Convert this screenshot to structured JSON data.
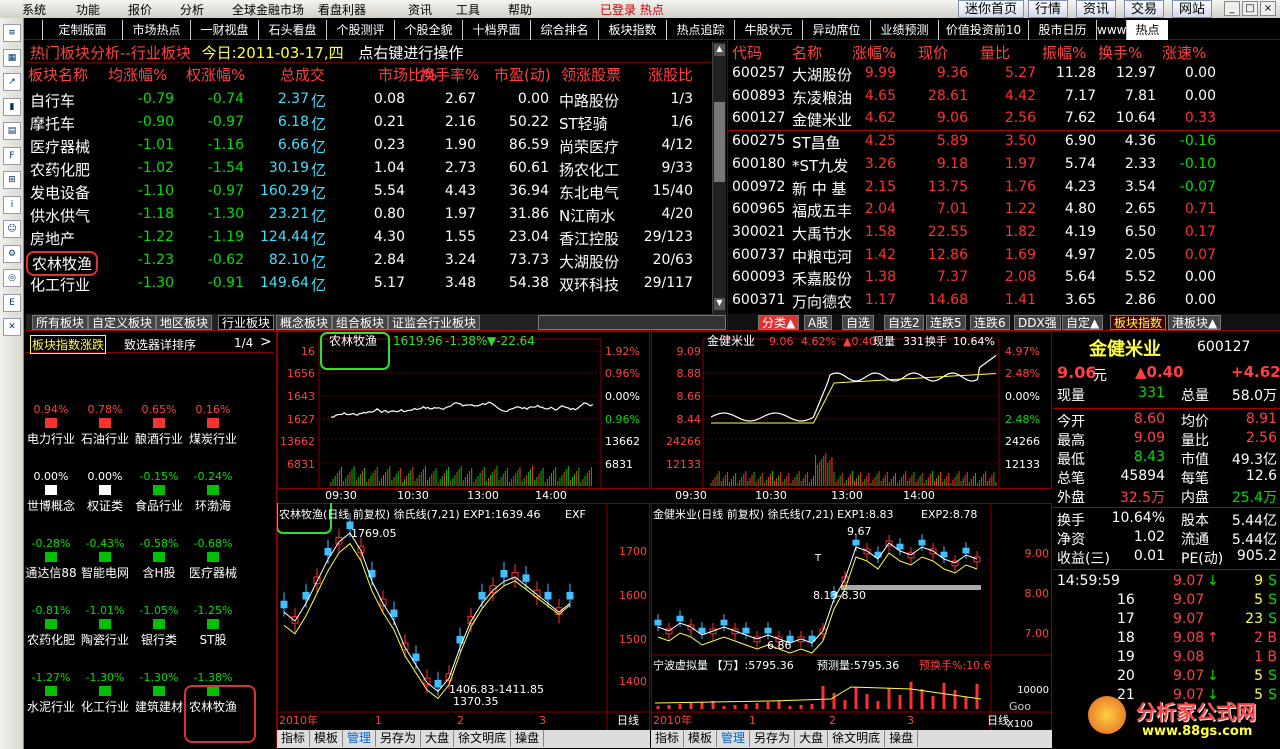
{
  "menu": [
    "系统",
    "功能",
    "报价",
    "分析",
    "全球金融市场",
    "看盘利器",
    "资讯",
    "工具",
    "帮助"
  ],
  "window_title": "已登录 热点",
  "top_buttons": [
    "迷你首页",
    "行情",
    "资讯",
    "交易",
    "网站"
  ],
  "window_controls": [
    "_",
    "□",
    "×"
  ],
  "tabs": [
    "定制版面",
    "市场热点",
    "一财视盘",
    "石头看盘",
    "个股测评",
    "个股全貌",
    "十档界面",
    "综合排名",
    "板块指数",
    "热点追踪",
    "牛股状元",
    "异动席位",
    "业绩预测",
    "价值投资前10",
    "股市日历",
    "www",
    "热点"
  ],
  "section_title": "热门板块分析--行业板块",
  "section_date": "今日:2011-03-17,四",
  "section_hint": "点右键进行操作",
  "left_headers": [
    "板块名称",
    "均涨幅%",
    "权涨幅%",
    "总成交",
    "市场比%",
    "换手率%",
    "市盈(动)",
    "领涨股票",
    "涨股比"
  ],
  "sectors": [
    {
      "name": "自行车",
      "avg": "-0.79",
      "wt": "-0.74",
      "vol": "2.37",
      "unit": "亿",
      "mkt": "0.08",
      "turn": "2.67",
      "pe": "0.00",
      "lead": "中路股份",
      "ratio": "1/3"
    },
    {
      "name": "摩托车",
      "avg": "-0.90",
      "wt": "-0.97",
      "vol": "6.18",
      "unit": "亿",
      "mkt": "0.21",
      "turn": "2.16",
      "pe": "50.22",
      "lead": "ST轻骑",
      "ratio": "1/6"
    },
    {
      "name": "医疗器械",
      "avg": "-1.01",
      "wt": "-1.16",
      "vol": "6.66",
      "unit": "亿",
      "mkt": "0.23",
      "turn": "1.90",
      "pe": "86.59",
      "lead": "尚荣医疗",
      "ratio": "4/12"
    },
    {
      "name": "农药化肥",
      "avg": "-1.02",
      "wt": "-1.54",
      "vol": "30.19",
      "unit": "亿",
      "mkt": "1.04",
      "turn": "2.73",
      "pe": "60.61",
      "lead": "扬农化工",
      "ratio": "9/33"
    },
    {
      "name": "发电设备",
      "avg": "-1.10",
      "wt": "-0.97",
      "vol": "160.29",
      "unit": "亿",
      "mkt": "5.54",
      "turn": "4.43",
      "pe": "36.94",
      "lead": "东北电气",
      "ratio": "15/40"
    },
    {
      "name": "供水供气",
      "avg": "-1.18",
      "wt": "-1.30",
      "vol": "23.21",
      "unit": "亿",
      "mkt": "0.80",
      "turn": "1.97",
      "pe": "31.86",
      "lead": "N江南水",
      "ratio": "4/20"
    },
    {
      "name": "房地产",
      "avg": "-1.22",
      "wt": "-1.19",
      "vol": "124.44",
      "unit": "亿",
      "mkt": "4.30",
      "turn": "1.55",
      "pe": "23.04",
      "lead": "香江控股",
      "ratio": "29/123"
    },
    {
      "name": "农林牧渔",
      "avg": "-1.23",
      "wt": "-0.62",
      "vol": "82.10",
      "unit": "亿",
      "mkt": "2.84",
      "turn": "3.24",
      "pe": "73.73",
      "lead": "大湖股份",
      "ratio": "20/63"
    },
    {
      "name": "化工行业",
      "avg": "-1.30",
      "wt": "-0.91",
      "vol": "149.64",
      "unit": "亿",
      "mkt": "5.17",
      "turn": "3.48",
      "pe": "54.38",
      "lead": "双环科技",
      "ratio": "29/117"
    }
  ],
  "right_headers": [
    "代码",
    "名称",
    "涨幅%",
    "现价",
    "量比",
    "振幅%",
    "换手%",
    "涨速%"
  ],
  "stocks": [
    {
      "code": "600257",
      "name": "大湖股份",
      "chg": "9.99",
      "price": "9.36",
      "vr": "5.27",
      "amp": "11.28",
      "turn": "12.97",
      "speed": "0.00",
      "sc": "w"
    },
    {
      "code": "600893",
      "name": "东凌粮油",
      "chg": "4.65",
      "price": "28.61",
      "vr": "4.42",
      "amp": "7.17",
      "turn": "7.81",
      "speed": "0.00",
      "sc": "w"
    },
    {
      "code": "600127",
      "name": "金健米业",
      "chg": "4.62",
      "price": "9.06",
      "vr": "2.56",
      "amp": "7.62",
      "turn": "10.64",
      "speed": "0.33",
      "sc": "r"
    },
    {
      "code": "600275",
      "name": "ST昌鱼",
      "chg": "4.25",
      "price": "5.89",
      "vr": "3.50",
      "amp": "6.90",
      "turn": "4.36",
      "speed": "-0.16",
      "sc": "g"
    },
    {
      "code": "600180",
      "name": "*ST九发",
      "chg": "3.26",
      "price": "9.18",
      "vr": "1.97",
      "amp": "5.74",
      "turn": "2.33",
      "speed": "-0.10",
      "sc": "g"
    },
    {
      "code": "000972",
      "name": "新 中 基",
      "chg": "2.15",
      "price": "13.75",
      "vr": "1.76",
      "amp": "4.23",
      "turn": "3.54",
      "speed": "-0.07",
      "sc": "g"
    },
    {
      "code": "600965",
      "name": "福成五丰",
      "chg": "2.04",
      "price": "7.01",
      "vr": "1.22",
      "amp": "4.80",
      "turn": "2.65",
      "speed": "0.71",
      "sc": "r"
    },
    {
      "code": "300021",
      "name": "大禹节水",
      "chg": "1.58",
      "price": "22.55",
      "vr": "1.82",
      "amp": "4.19",
      "turn": "6.50",
      "speed": "0.17",
      "sc": "r"
    },
    {
      "code": "600737",
      "name": "中粮屯河",
      "chg": "1.42",
      "price": "12.86",
      "vr": "1.69",
      "amp": "4.97",
      "turn": "2.05",
      "speed": "0.07",
      "sc": "r"
    },
    {
      "code": "600093",
      "name": "禾嘉股份",
      "chg": "1.38",
      "price": "7.37",
      "vr": "2.08",
      "amp": "5.64",
      "turn": "5.52",
      "speed": "0.00",
      "sc": "w"
    },
    {
      "code": "600371",
      "name": "万向德农",
      "chg": "1.17",
      "price": "14.68",
      "vr": "1.41",
      "amp": "3.65",
      "turn": "2.86",
      "speed": "0.00",
      "sc": "w"
    }
  ],
  "left_bottom_tabs": [
    "所有板块",
    "自定义板块",
    "地区板块",
    "行业板块",
    "概念板块",
    "组合板块",
    "证监会行业板块"
  ],
  "right_bottom_tabs": [
    "分类▲",
    "A股",
    "自选",
    "自选2",
    "连跌5",
    "连跌6",
    "DDX强",
    "自定▲",
    "板块指数",
    "港板块▲"
  ],
  "heat_header": {
    "t1": "板块指数涨跌",
    "t2": "致选器详排序",
    "page": "1/4",
    "arrow": ">"
  },
  "heat_cells": [
    {
      "pct": "0.94%",
      "lbl": "电力行业",
      "c": "r"
    },
    {
      "pct": "0.78%",
      "lbl": "石油行业",
      "c": "r"
    },
    {
      "pct": "0.65%",
      "lbl": "酿酒行业",
      "c": "r"
    },
    {
      "pct": "0.16%",
      "lbl": "煤炭行业",
      "c": "r"
    },
    {
      "pct": "0.00%",
      "lbl": "世博概念",
      "c": "w"
    },
    {
      "pct": "0.00%",
      "lbl": "权证类",
      "c": "w"
    },
    {
      "pct": "-0.15%",
      "lbl": "食品行业",
      "c": "g"
    },
    {
      "pct": "-0.24%",
      "lbl": "环渤海",
      "c": "g"
    },
    {
      "pct": "-0.28%",
      "lbl": "通达信88",
      "c": "g"
    },
    {
      "pct": "-0.43%",
      "lbl": "智能电网",
      "c": "g"
    },
    {
      "pct": "-0.58%",
      "lbl": "含H股",
      "c": "g"
    },
    {
      "pct": "-0.68%",
      "lbl": "医疗器械",
      "c": "g"
    },
    {
      "pct": "-0.81%",
      "lbl": "农药化肥",
      "c": "g"
    },
    {
      "pct": "-1.01%",
      "lbl": "陶瓷行业",
      "c": "g"
    },
    {
      "pct": "-1.05%",
      "lbl": "银行类",
      "c": "g"
    },
    {
      "pct": "-1.25%",
      "lbl": "ST股",
      "c": "g"
    },
    {
      "pct": "-1.27%",
      "lbl": "水泥行业",
      "c": "g"
    },
    {
      "pct": "-1.30%",
      "lbl": "化工行业",
      "c": "g"
    },
    {
      "pct": "-1.30%",
      "lbl": "建筑建材",
      "c": "g"
    },
    {
      "pct": "-1.38%",
      "lbl": "农林牧渔",
      "c": "g"
    }
  ],
  "mid_top": {
    "name": "农林牧渔",
    "price": "1619.96",
    "chg": "-1.38%",
    "delta": "▼-22.64",
    "yl": [
      "16",
      "1656",
      "1643",
      "1627",
      "13662",
      "6831"
    ],
    "yr": [
      "1.92%",
      "0.96%",
      "0.00%",
      "0.96%",
      "13662",
      "6831"
    ],
    "times": [
      "09:30",
      "10:30",
      "13:00",
      "14:00"
    ]
  },
  "mid_bot": {
    "title": "农林牧渔(日线 前复权) 徐氏线(7,21) EXP1:1639.46",
    "exp2": "EXF",
    "high": "1769.05",
    "low1": "1406.83-1411.85",
    "low2": "1370.35",
    "yr": [
      "1700",
      "1600",
      "1500",
      "1400"
    ],
    "year": "2010年",
    "m1": "1",
    "m2": "2",
    "m3": "3",
    "period": "日线",
    "tools": [
      "指标",
      "模板",
      "管理",
      "另存为",
      "大盘",
      "徐文明底",
      "操盘"
    ]
  },
  "right_top": {
    "name": "金健米业",
    "price": "9.06",
    "chg": "4.62%",
    "delta": "▲0.40",
    "vol_label": "现量",
    "vol": "331",
    "turn_label": "换手",
    "turn": "10.64%",
    "yl": [
      "9.09",
      "8.88",
      "8.66",
      "8.44",
      "24266",
      "12133"
    ],
    "yr": [
      "4.97%",
      "2.48%",
      "0.00%",
      "2.48%",
      "24266",
      "12133"
    ],
    "times": [
      "09:30",
      "10:30",
      "13:00",
      "14:00"
    ]
  },
  "right_bot": {
    "title": "金健米业(日线 前复权) 徐氏线(7,21) EXP1:8.83",
    "exp2": "EXP2:8.78",
    "high": "9.67",
    "mid": "8.13-8.30",
    "low": "6.86",
    "mark": "T",
    "yr": [
      "9.00",
      "8.00",
      "7.00"
    ],
    "vol_title": "宁波虚拟量 【万】:5795.36",
    "vol_pred": "预测量:5795.36",
    "vol_turn": "预换手%:10.6",
    "vol_axis": "10000",
    "vol_mult": "X100",
    "year": "2010年",
    "m1": "1",
    "m2": "2",
    "m3": "3",
    "period": "日线",
    "brand": "Goo",
    "tools": [
      "指标",
      "模板",
      "管理",
      "另存为",
      "大盘",
      "徐文明底",
      "操盘"
    ]
  },
  "quote": {
    "name": "金健米业",
    "code": "600127",
    "price": "9.06",
    "unit": "元",
    "delta": "▲0.40",
    "pct": "+4.62",
    "rows": [
      [
        "现量",
        "331",
        "总量",
        "58.0万"
      ],
      [
        "今开",
        "8.60",
        "均价",
        "8.91"
      ],
      [
        "最高",
        "9.09",
        "量比",
        "2.56"
      ],
      [
        "最低",
        "8.43",
        "市值",
        "49.3亿"
      ],
      [
        "总笔",
        "45894",
        "每笔",
        "12.6"
      ],
      [
        "外盘",
        "32.5万",
        "内盘",
        "25.4万"
      ],
      [
        "换手",
        "10.64%",
        "股本",
        "5.44亿"
      ],
      [
        "净资",
        "1.02",
        "流通",
        "5.44亿"
      ],
      [
        "收益(三)",
        "0.01",
        "PE(动)",
        "905.2"
      ]
    ],
    "ticks": [
      [
        "14:59:59",
        "9.07",
        "↓",
        "9",
        "S"
      ],
      [
        "16",
        "9.07",
        "",
        "5",
        "S"
      ],
      [
        "17",
        "9.07",
        "",
        "23",
        "S"
      ],
      [
        "18",
        "9.08",
        "↑",
        "2",
        "B"
      ],
      [
        "19",
        "9.08",
        "",
        "1",
        "B"
      ],
      [
        "20",
        "9.07",
        "↓",
        "5",
        "S"
      ],
      [
        "21",
        "9.07",
        "↓",
        "5",
        "S"
      ]
    ]
  },
  "watermark": {
    "line1": "分析家公式网",
    "line2": "www.88gs.com"
  },
  "colors": {
    "up": "#ff3030",
    "down": "#00e000",
    "accent": "#ffff40"
  }
}
